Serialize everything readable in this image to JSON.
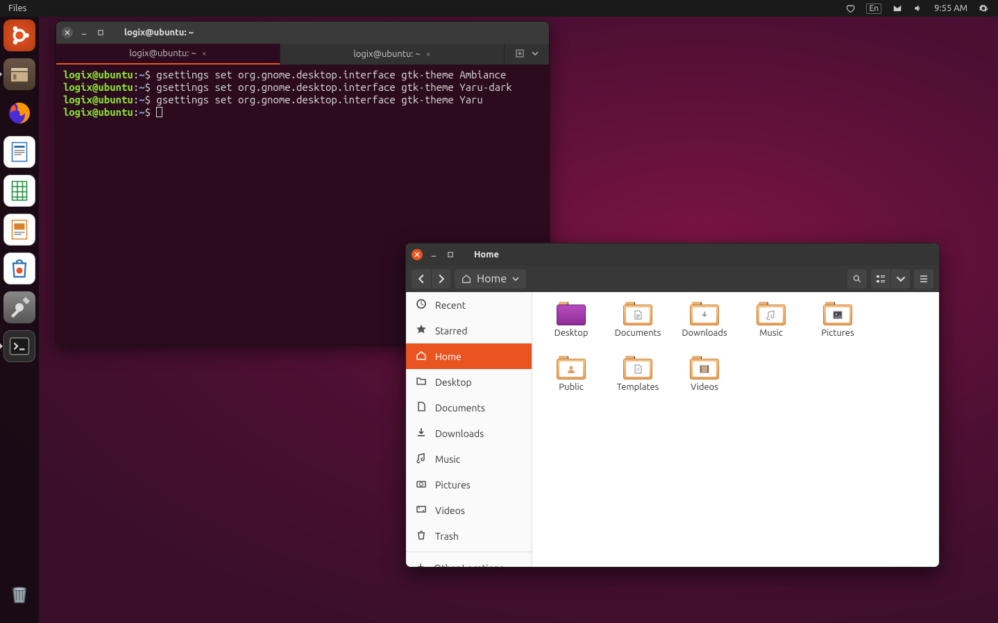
{
  "panel": {
    "menu": "Files",
    "lang": "En",
    "clock": "9:55 AM"
  },
  "dock": {
    "items": [
      {
        "name": "ubuntu",
        "running": false
      },
      {
        "name": "files",
        "running": true
      },
      {
        "name": "firefox",
        "running": false
      },
      {
        "name": "writer",
        "running": false
      },
      {
        "name": "calc",
        "running": false
      },
      {
        "name": "impress",
        "running": false
      },
      {
        "name": "software",
        "running": false
      },
      {
        "name": "settings",
        "running": false
      },
      {
        "name": "terminal",
        "running": true
      }
    ],
    "trash": "trash"
  },
  "terminal": {
    "title": "logix@ubuntu: ~",
    "tabs": [
      "logix@ubuntu: ~",
      "logix@ubuntu: ~"
    ],
    "active_tab": 0,
    "prompt_user": "logix@ubuntu",
    "prompt_path": "~",
    "prompt_sym": "$",
    "lines": [
      "gsettings set org.gnome.desktop.interface gtk-theme Ambiance",
      "gsettings set org.gnome.desktop.interface gtk-theme Yaru-dark",
      "gsettings set org.gnome.desktop.interface gtk-theme Yaru"
    ]
  },
  "files": {
    "title": "Home",
    "path_label": "Home",
    "sidebar": [
      {
        "id": "recent",
        "label": "Recent",
        "icon": "clock"
      },
      {
        "id": "starred",
        "label": "Starred",
        "icon": "star"
      },
      {
        "id": "home",
        "label": "Home",
        "icon": "home",
        "active": true
      },
      {
        "id": "desktop",
        "label": "Desktop",
        "icon": "folder"
      },
      {
        "id": "documents",
        "label": "Documents",
        "icon": "doc"
      },
      {
        "id": "downloads",
        "label": "Downloads",
        "icon": "down"
      },
      {
        "id": "music",
        "label": "Music",
        "icon": "music"
      },
      {
        "id": "pictures",
        "label": "Pictures",
        "icon": "camera"
      },
      {
        "id": "videos",
        "label": "Videos",
        "icon": "video"
      },
      {
        "id": "trash",
        "label": "Trash",
        "icon": "trash"
      }
    ],
    "sidebar_other": "Other Locations",
    "folders": [
      {
        "label": "Desktop",
        "kind": "desktop"
      },
      {
        "label": "Documents",
        "kind": "doc"
      },
      {
        "label": "Downloads",
        "kind": "down"
      },
      {
        "label": "Music",
        "kind": "music"
      },
      {
        "label": "Pictures",
        "kind": "pic"
      },
      {
        "label": "Public",
        "kind": "public"
      },
      {
        "label": "Templates",
        "kind": "tmpl"
      },
      {
        "label": "Videos",
        "kind": "video"
      }
    ]
  }
}
